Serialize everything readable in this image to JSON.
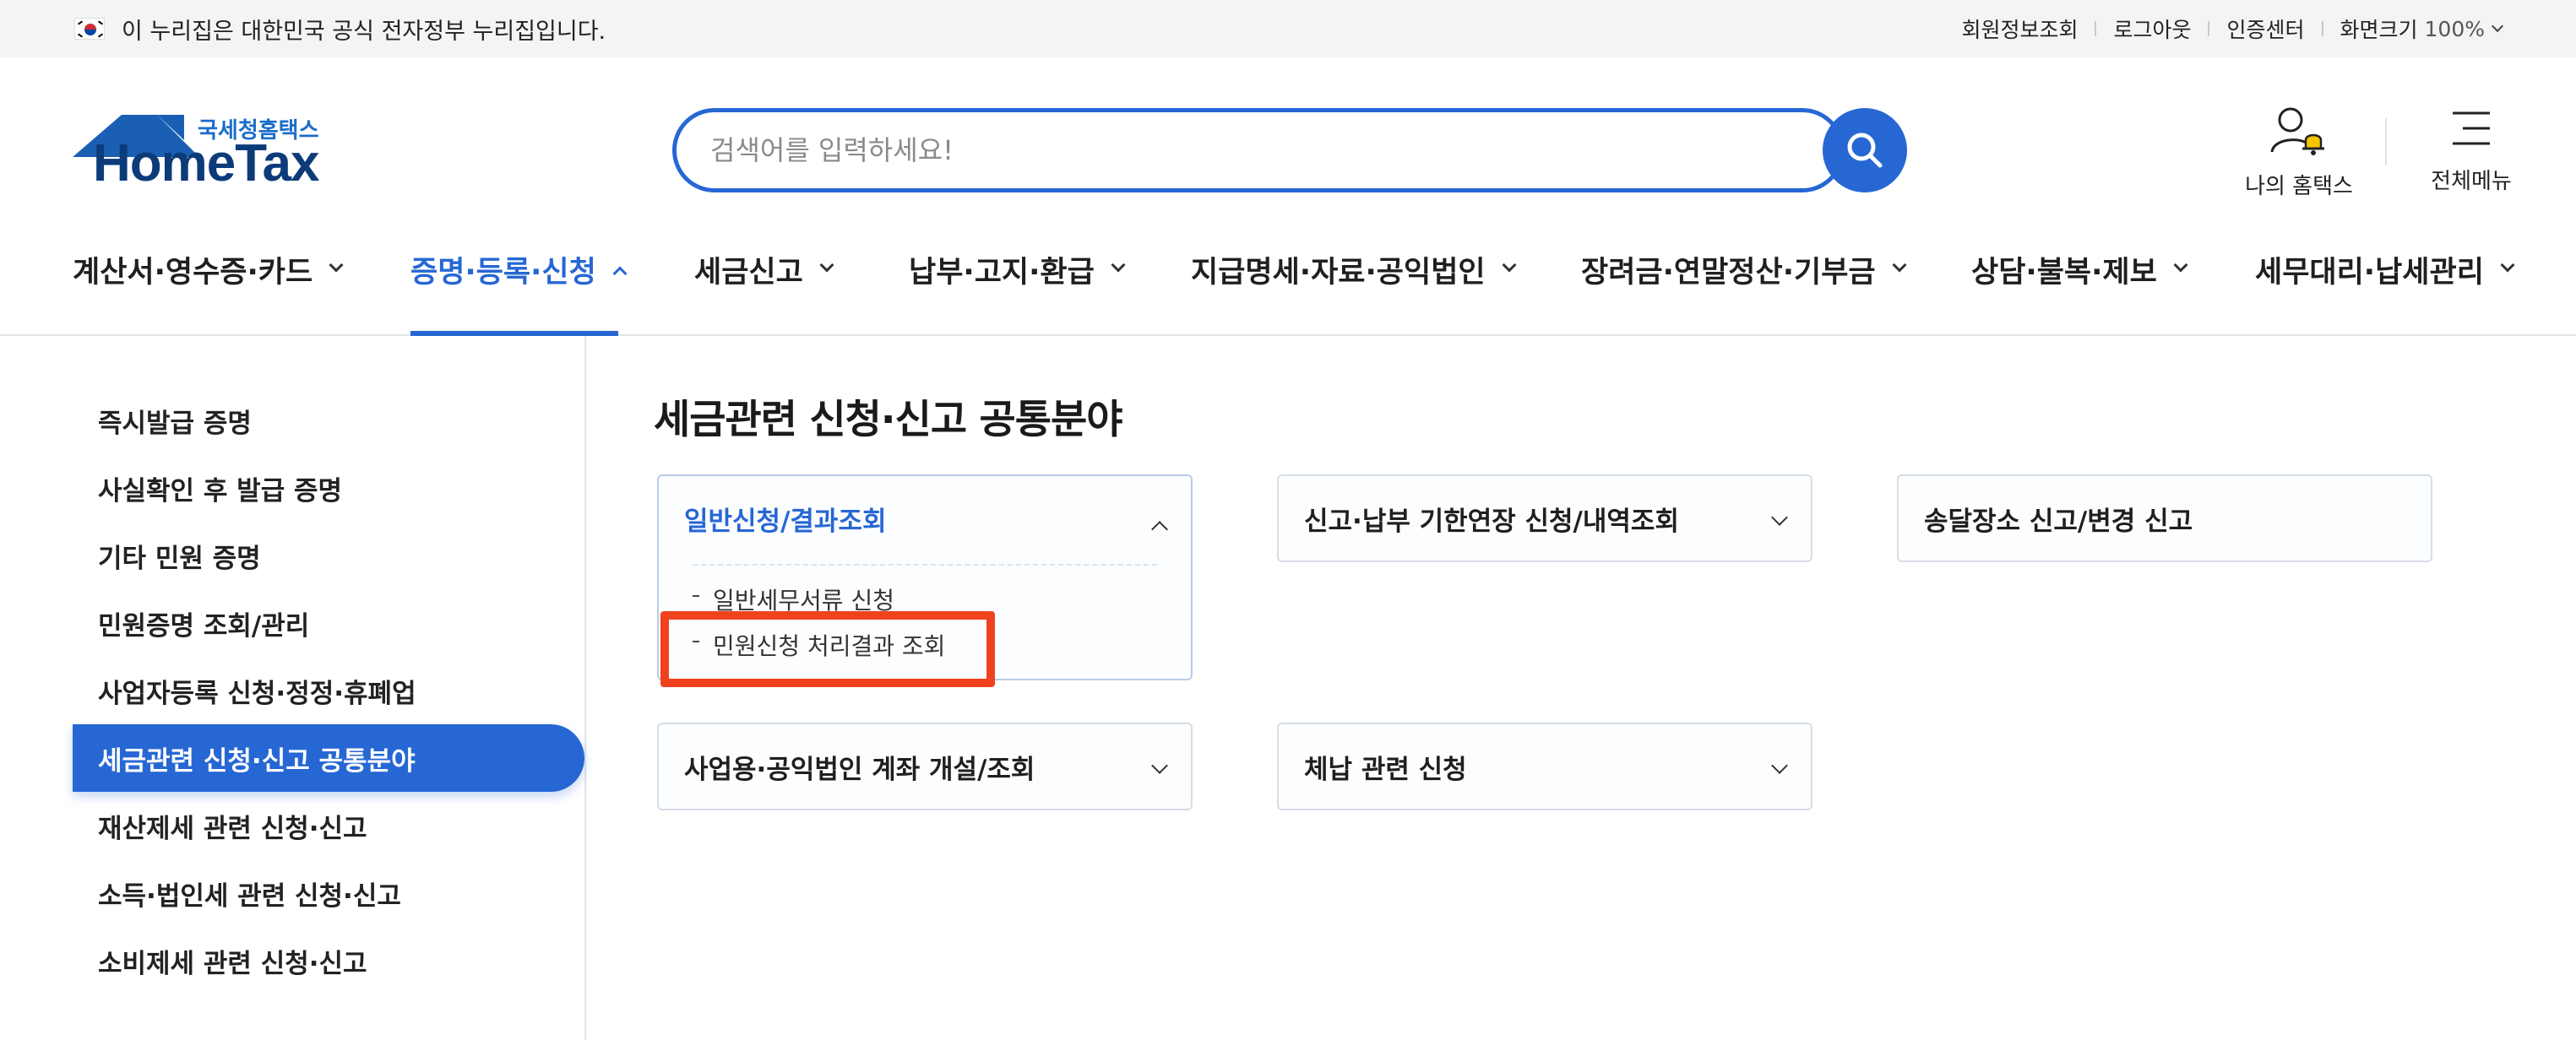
{
  "topbar": {
    "gov_notice": "이 누리집은 대한민국 공식 전자정부 누리집입니다.",
    "links": [
      "회원정보조회",
      "로그아웃",
      "인증센터"
    ],
    "zoom_label": "화면크기",
    "zoom_value": "100%"
  },
  "header": {
    "logo_sub": "국세청홈택스",
    "logo_main": "HomeTax",
    "search_placeholder": "검색어를 입력하세요!",
    "my_hometax": "나의 홈택스",
    "all_menu": "전체메뉴"
  },
  "gnb": {
    "items": [
      "계산서·영수증·카드",
      "증명·등록·신청",
      "세금신고",
      "납부·고지·환급",
      "지급명세·자료·공익법인",
      "장려금·연말정산·기부금",
      "상담·불복·제보",
      "세무대리·납세관리"
    ],
    "active_index": 1
  },
  "sidebar": {
    "items": [
      "즉시발급 증명",
      "사실확인 후 발급 증명",
      "기타 민원 증명",
      "민원증명 조회/관리",
      "사업자등록 신청·정정·휴폐업",
      "세금관련 신청·신고 공통분야",
      "재산제세 관련 신청·신고",
      "소득·법인세 관련 신청·신고",
      "소비제세 관련 신청·신고"
    ],
    "active_index": 5
  },
  "main": {
    "title": "세금관련 신청·신고 공통분야",
    "cards": [
      {
        "title": "일반신청/결과조회",
        "expanded": true,
        "sub_items": [
          "일반세무서류 신청",
          "민원신청 처리결과 조회"
        ]
      },
      {
        "title": "신고·납부 기한연장 신청/내역조회",
        "expanded": false
      },
      {
        "title": "송달장소 신고/변경 신고",
        "expanded": false
      },
      {
        "title": "사업용·공익법인 계좌 개설/조회",
        "expanded": false
      },
      {
        "title": "체납 관련 신청",
        "expanded": false
      }
    ]
  },
  "colors": {
    "accent": "#2667d4",
    "highlight": "#f0421f",
    "logo_text": "#0d3b7a"
  }
}
